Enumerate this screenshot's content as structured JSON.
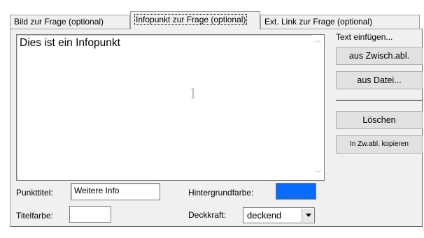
{
  "tabs": [
    {
      "label": "Bild zur Frage (optional)"
    },
    {
      "label": "Infopunkt zur Frage (optional)",
      "active": true
    },
    {
      "label": "Ext. Link zur Frage (optional)"
    }
  ],
  "memo": {
    "text": "Dies ist ein Infopunkt"
  },
  "insert_text": {
    "label": "Text einfügen...",
    "from_clipboard": "aus Zwisch.abl.",
    "from_file": "aus Datei..."
  },
  "actions": {
    "delete": "Löschen",
    "copy_to_clipboard": "In Zw.abl. kopieren"
  },
  "fields": {
    "point_title_label": "Punkttitel:",
    "point_title_value": "Weitere Info",
    "background_label": "Hintergrundfarbe:",
    "background_color": "#0a6cff",
    "title_color_label": "Titelfarbe:",
    "title_color": "#ffffff",
    "opacity_label": "Deckkraft:",
    "opacity_value": "deckend"
  }
}
